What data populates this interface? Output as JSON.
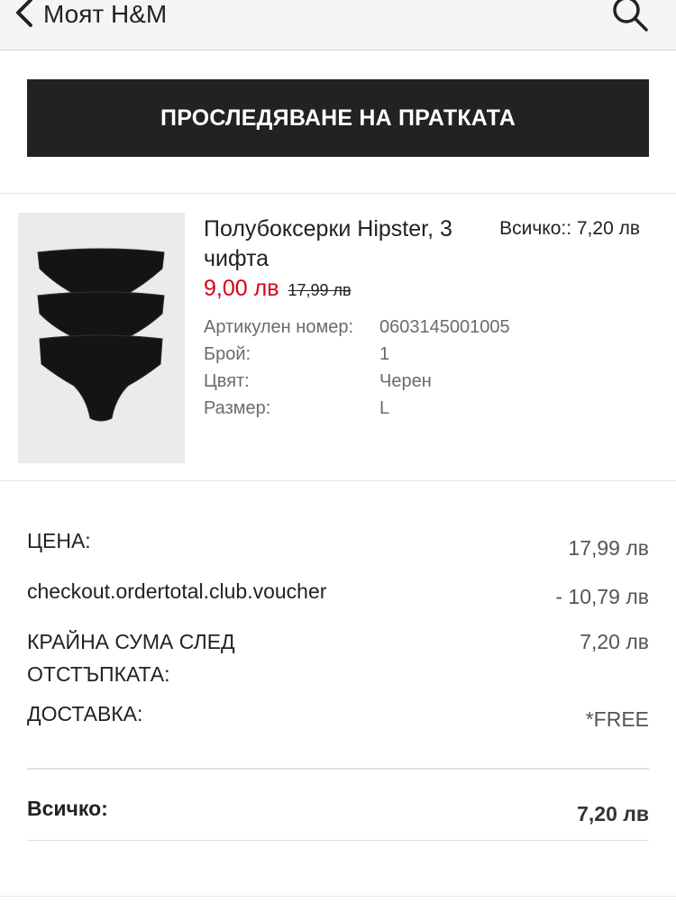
{
  "header": {
    "back_label": "Моят H&M",
    "back_icon": "chevron-left-icon",
    "search_icon": "search-icon"
  },
  "track_button": {
    "label": "ПРОСЛЕДЯВАНЕ НА ПРАТКАТА"
  },
  "product": {
    "name": "Полубоксерки Hipster, 3 чифта",
    "total": "Всичко:: 7,20 лв",
    "price": "9,00 лв",
    "old_price": "17,99 лв",
    "details": [
      {
        "label": "Артикулен номер:",
        "value": "0603145001005"
      },
      {
        "label": "Брой:",
        "value": "1"
      },
      {
        "label": "Цвят:",
        "value": "Черен"
      },
      {
        "label": "Размер:",
        "value": "L"
      }
    ]
  },
  "summary": {
    "rows": [
      {
        "label": "ЦЕНА:",
        "value": "17,99 лв"
      },
      {
        "label": "checkout.ordertotal.club.voucher",
        "value": "- 10,79 лв"
      },
      {
        "label": "КРАЙНА СУМА СЛЕД ОТСТЪПКАТА:",
        "value": "7,20 лв"
      },
      {
        "label": "ДОСТАВКА:",
        "value": "*FREE"
      }
    ],
    "total_label": "Всичко:",
    "total_value": "7,20 лв"
  },
  "colors": {
    "accent_dark": "#222222",
    "sale_red": "#d6001c"
  }
}
